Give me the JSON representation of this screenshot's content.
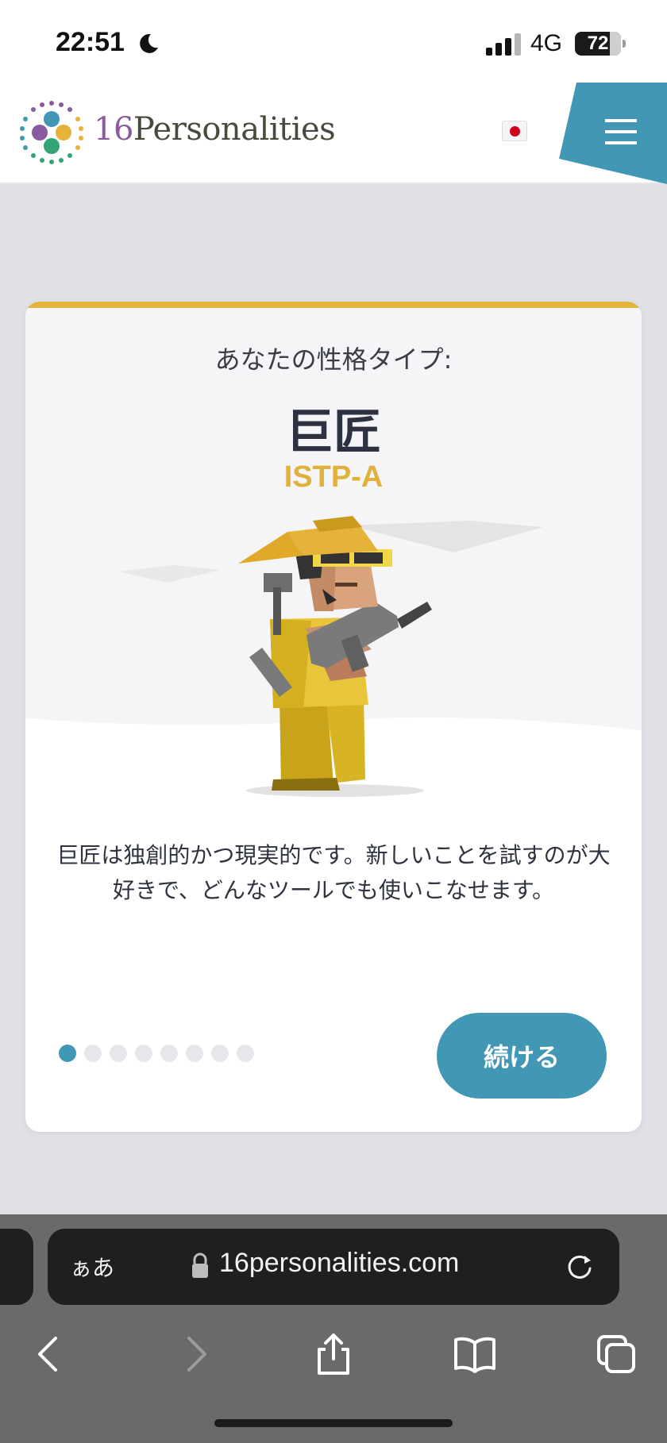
{
  "status_bar": {
    "time": "22:51",
    "network": "4G",
    "battery": "72"
  },
  "header": {
    "logo_number": "16",
    "logo_word": "Personalities",
    "language_flag": "jp-flag",
    "menu_icon": "hamburger-icon"
  },
  "card": {
    "subtitle": "あなたの性格タイプ:",
    "title": "巨匠",
    "code": "ISTP-A",
    "description": "巨匠は独創的かつ現実的です。新しいことを試すのが大好きで、どんなツールでも使いこなせます。",
    "continue_label": "続ける",
    "pagination": {
      "current": 1,
      "total": 8
    },
    "accent_color": "#e6b33a",
    "button_color": "#4298b4"
  },
  "browser": {
    "aa_label": "ぁあ",
    "url": "16personalities.com",
    "toolbar": [
      "back-icon",
      "forward-icon",
      "share-icon",
      "bookmarks-icon",
      "tabs-icon"
    ]
  }
}
